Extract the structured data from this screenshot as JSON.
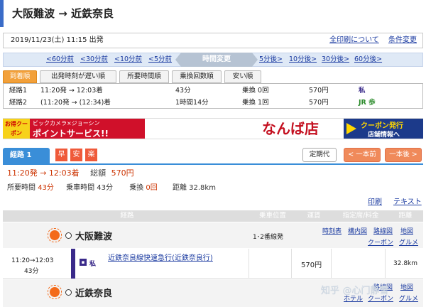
{
  "title": "大阪難波 → 近鉄奈良",
  "datebar": {
    "datetime": "2019/11/23(土) 11:15 出発",
    "print_all": "全印刷について",
    "conditions": "条件変更"
  },
  "timebar": {
    "prev": [
      "<60分前",
      "<30分前",
      "<10分前",
      "<5分前"
    ],
    "change": "時間変更",
    "next": [
      "5分後>",
      "10分後>",
      "30分後>",
      "60分後>"
    ]
  },
  "sort_tabs": [
    "到着順",
    "出発時刻が遅い順",
    "所要時間順",
    "乗換回数順",
    "安い順"
  ],
  "routes": [
    {
      "name": "経路1",
      "time": "11:20発 → 12:03着",
      "duration": "43分",
      "transfer": "乗換 0回",
      "fare": "570円",
      "mark": "私"
    },
    {
      "name": "経路2",
      "time": "(11:20発 → (12:34)着",
      "duration": "1時間14分",
      "transfer": "乗換 1回",
      "fare": "570円",
      "mark": "JR 歩"
    }
  ],
  "banner": {
    "otoku": "お得クーポン",
    "bic": "ビックカメラ×ジョーシン",
    "point": "ポイントサービス!!",
    "nanba": "なんば店",
    "coupon": "クーポン発行",
    "store_info": "店舗情報へ"
  },
  "route_tabs": {
    "active": "経路 1",
    "badges": [
      "早",
      "安",
      "楽"
    ],
    "teiki": "定期代",
    "prev": "< 一本前",
    "next": "一本後 >"
  },
  "summary": {
    "time": "11:20発 → 12:03着",
    "total_label": "総額",
    "total": "570円",
    "req_label": "所要時間",
    "req": "43分",
    "ride_label": "乗車時間",
    "ride": "43分",
    "trans_label": "乗換",
    "trans": "0回",
    "dist_label": "距離",
    "dist": "32.8km"
  },
  "print_links": {
    "print": "印刷",
    "text": "テキスト"
  },
  "headers": [
    "経路",
    "乗車位置",
    "運賃",
    "指定席/料金",
    "距離"
  ],
  "station1": {
    "name": "大阪難波",
    "platform": "1･2番線発",
    "links_row1": [
      "時刻表",
      "構内図",
      "路線図",
      "地図"
    ],
    "links_row2": [
      "クーポン",
      "グルメ"
    ]
  },
  "segment": {
    "time": "11:20→12:03",
    "duration": "43分",
    "line": "近鉄奈良線快速急行(近鉄奈良行)",
    "fare": "570円",
    "dist": "32.8km"
  },
  "station2": {
    "name": "近鉄奈良",
    "links_row1": [
      "路線図",
      "地図"
    ],
    "links_row2": [
      "ホテル",
      "クーポン",
      "グルメ"
    ]
  },
  "watermark": "知乎 @心门静雪",
  "colors": {
    "accent_blue": "#3a8ed8",
    "fare_red": "#cc3300",
    "link": "#1a3aa0",
    "tab_orange": "#f2a03a"
  }
}
